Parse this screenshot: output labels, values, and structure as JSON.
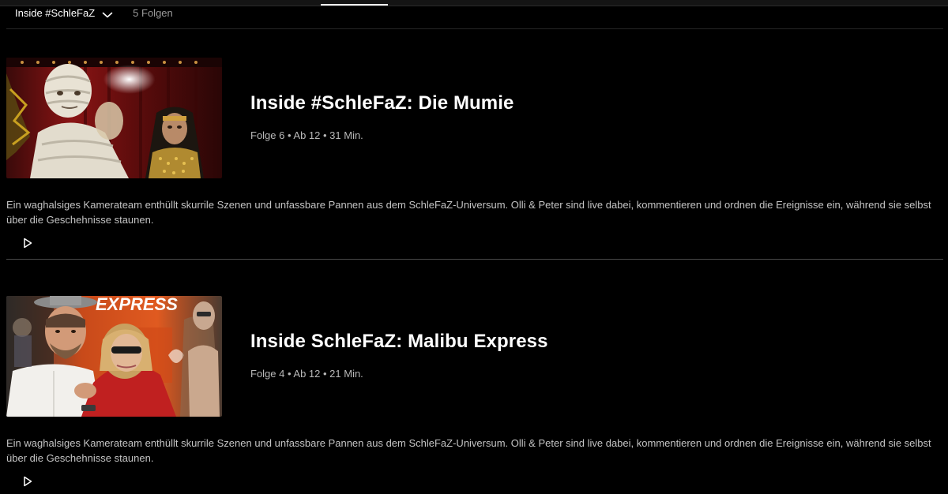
{
  "header": {
    "season_label": "Inside #SchleFaZ",
    "episode_count": "5 Folgen",
    "chevron_icon": "chevron-down-icon"
  },
  "episodes": [
    {
      "title": "Inside #SchleFaZ: Die Mumie",
      "meta": "Folge 6 • Ab 12 • 31 Min.",
      "description": "Ein waghalsiges Kamerateam enthüllt skurrile Szenen und unfassbare Pannen aus dem SchleFaZ-Universum. Olli & Peter sind live dabei, kommentieren und ordnen die Ereignisse ein, während sie selbst über die Geschehnisse staunen.",
      "play_icon": "play-icon"
    },
    {
      "title": "Inside SchleFaZ: Malibu Express",
      "meta": "Folge 4 • Ab 12 • 21 Min.",
      "description": "Ein waghalsiges Kamerateam enthüllt skurrile Szenen und unfassbare Pannen aus dem SchleFaZ-Universum. Olli & Peter sind live dabei, kommentieren und ordnen die Ereignisse ein, während sie selbst über die Geschehnisse staunen.",
      "play_icon": "play-icon"
    }
  ],
  "thumbnail_texts": {
    "poster_word": "EXPRESS"
  },
  "colors": {
    "background": "#000000",
    "text_primary": "#ffffff",
    "text_secondary": "#b8b8b8",
    "divider": "#4a4a4a"
  }
}
